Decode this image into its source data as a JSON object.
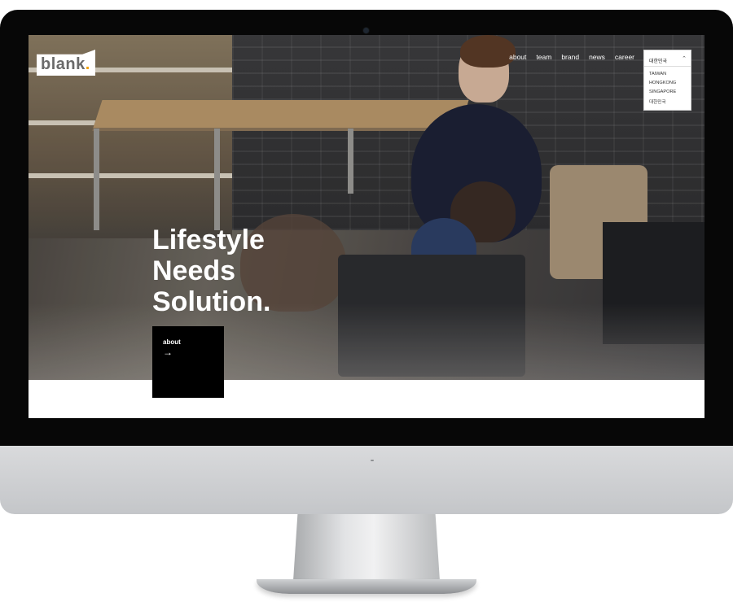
{
  "brand": {
    "logo_text": "blank",
    "logo_dot": "."
  },
  "nav": {
    "items": [
      "about",
      "team",
      "brand",
      "news",
      "career"
    ]
  },
  "language": {
    "current": "대한민국",
    "caret": "⌃",
    "options": [
      "TAIWAN",
      "HONGKONG",
      "SINGAPORE",
      "대한민국"
    ]
  },
  "hero": {
    "line1": "Lifestyle",
    "line2": "Needs",
    "line3": "Solution.",
    "cta_label": "about",
    "cta_arrow": "→"
  },
  "colors": {
    "logo_accent": "#f2a20e",
    "cta_background": "#000000",
    "text_on_hero": "#ffffff"
  },
  "icons": [
    "arrow-right-icon",
    "caret-up-icon",
    "camera-icon",
    "apple-logo-icon"
  ]
}
